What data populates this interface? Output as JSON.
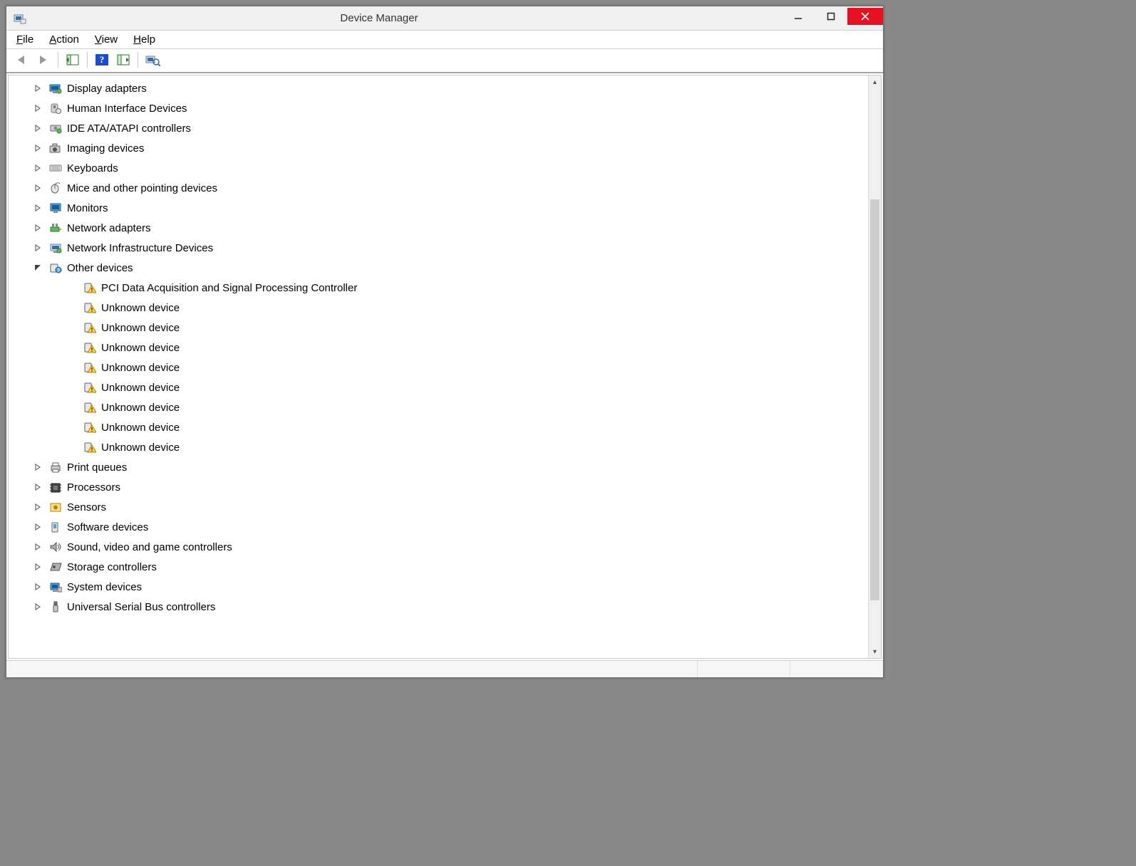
{
  "window": {
    "title": "Device Manager"
  },
  "menu": {
    "file": "File",
    "action": "Action",
    "view": "View",
    "help": "Help"
  },
  "toolbar_icons": {
    "back": "back-icon",
    "forward": "forward-icon",
    "show_hide": "show-hide-tree-icon",
    "help": "help-icon",
    "props": "properties-icon",
    "scan": "scan-hardware-icon"
  },
  "tree": [
    {
      "label": "Display adapters",
      "icon": "display-adapter-icon",
      "expanded": false,
      "children": []
    },
    {
      "label": "Human Interface Devices",
      "icon": "hid-icon",
      "expanded": false,
      "children": []
    },
    {
      "label": "IDE ATA/ATAPI controllers",
      "icon": "ide-controller-icon",
      "expanded": false,
      "children": []
    },
    {
      "label": "Imaging devices",
      "icon": "imaging-device-icon",
      "expanded": false,
      "children": []
    },
    {
      "label": "Keyboards",
      "icon": "keyboard-icon",
      "expanded": false,
      "children": []
    },
    {
      "label": "Mice and other pointing devices",
      "icon": "mouse-icon",
      "expanded": false,
      "children": []
    },
    {
      "label": "Monitors",
      "icon": "monitor-icon",
      "expanded": false,
      "children": []
    },
    {
      "label": "Network adapters",
      "icon": "network-adapter-icon",
      "expanded": false,
      "children": []
    },
    {
      "label": "Network Infrastructure Devices",
      "icon": "network-infra-icon",
      "expanded": false,
      "children": []
    },
    {
      "label": "Other devices",
      "icon": "unknown-device-icon",
      "expanded": true,
      "children": [
        {
          "label": "PCI Data Acquisition and Signal Processing Controller",
          "icon": "warning-device-icon"
        },
        {
          "label": "Unknown device",
          "icon": "warning-device-icon"
        },
        {
          "label": "Unknown device",
          "icon": "warning-device-icon"
        },
        {
          "label": "Unknown device",
          "icon": "warning-device-icon"
        },
        {
          "label": "Unknown device",
          "icon": "warning-device-icon"
        },
        {
          "label": "Unknown device",
          "icon": "warning-device-icon"
        },
        {
          "label": "Unknown device",
          "icon": "warning-device-icon"
        },
        {
          "label": "Unknown device",
          "icon": "warning-device-icon"
        },
        {
          "label": "Unknown device",
          "icon": "warning-device-icon"
        }
      ]
    },
    {
      "label": "Print queues",
      "icon": "printer-icon",
      "expanded": false,
      "children": []
    },
    {
      "label": "Processors",
      "icon": "processor-icon",
      "expanded": false,
      "children": []
    },
    {
      "label": "Sensors",
      "icon": "sensor-icon",
      "expanded": false,
      "children": []
    },
    {
      "label": "Software devices",
      "icon": "software-device-icon",
      "expanded": false,
      "children": []
    },
    {
      "label": "Sound, video and game controllers",
      "icon": "sound-icon",
      "expanded": false,
      "children": []
    },
    {
      "label": "Storage controllers",
      "icon": "storage-controller-icon",
      "expanded": false,
      "children": []
    },
    {
      "label": "System devices",
      "icon": "system-device-icon",
      "expanded": false,
      "children": []
    },
    {
      "label": "Universal Serial Bus controllers",
      "icon": "usb-icon",
      "expanded": false,
      "children": []
    }
  ]
}
